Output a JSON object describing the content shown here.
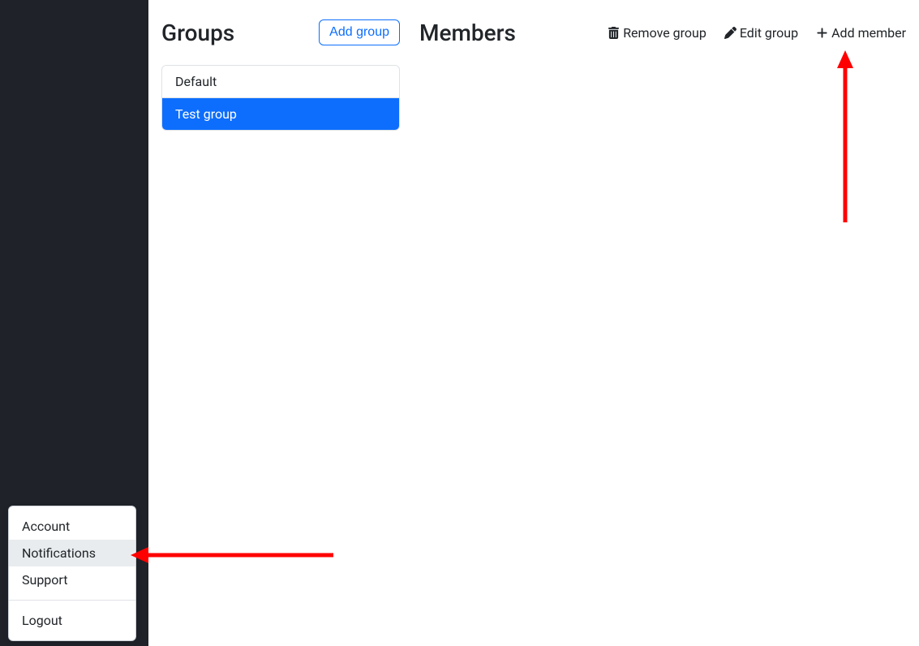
{
  "groups": {
    "title": "Groups",
    "add_button": "Add group",
    "items": [
      {
        "label": "Default",
        "active": false
      },
      {
        "label": "Test group",
        "active": true
      }
    ]
  },
  "members": {
    "title": "Members",
    "actions": {
      "remove": "Remove group",
      "edit": "Edit group",
      "add": "Add member"
    }
  },
  "menu": {
    "items": [
      {
        "label": "Account",
        "hovered": false
      },
      {
        "label": "Notifications",
        "hovered": true
      },
      {
        "label": "Support",
        "hovered": false
      }
    ],
    "logout": "Logout"
  }
}
